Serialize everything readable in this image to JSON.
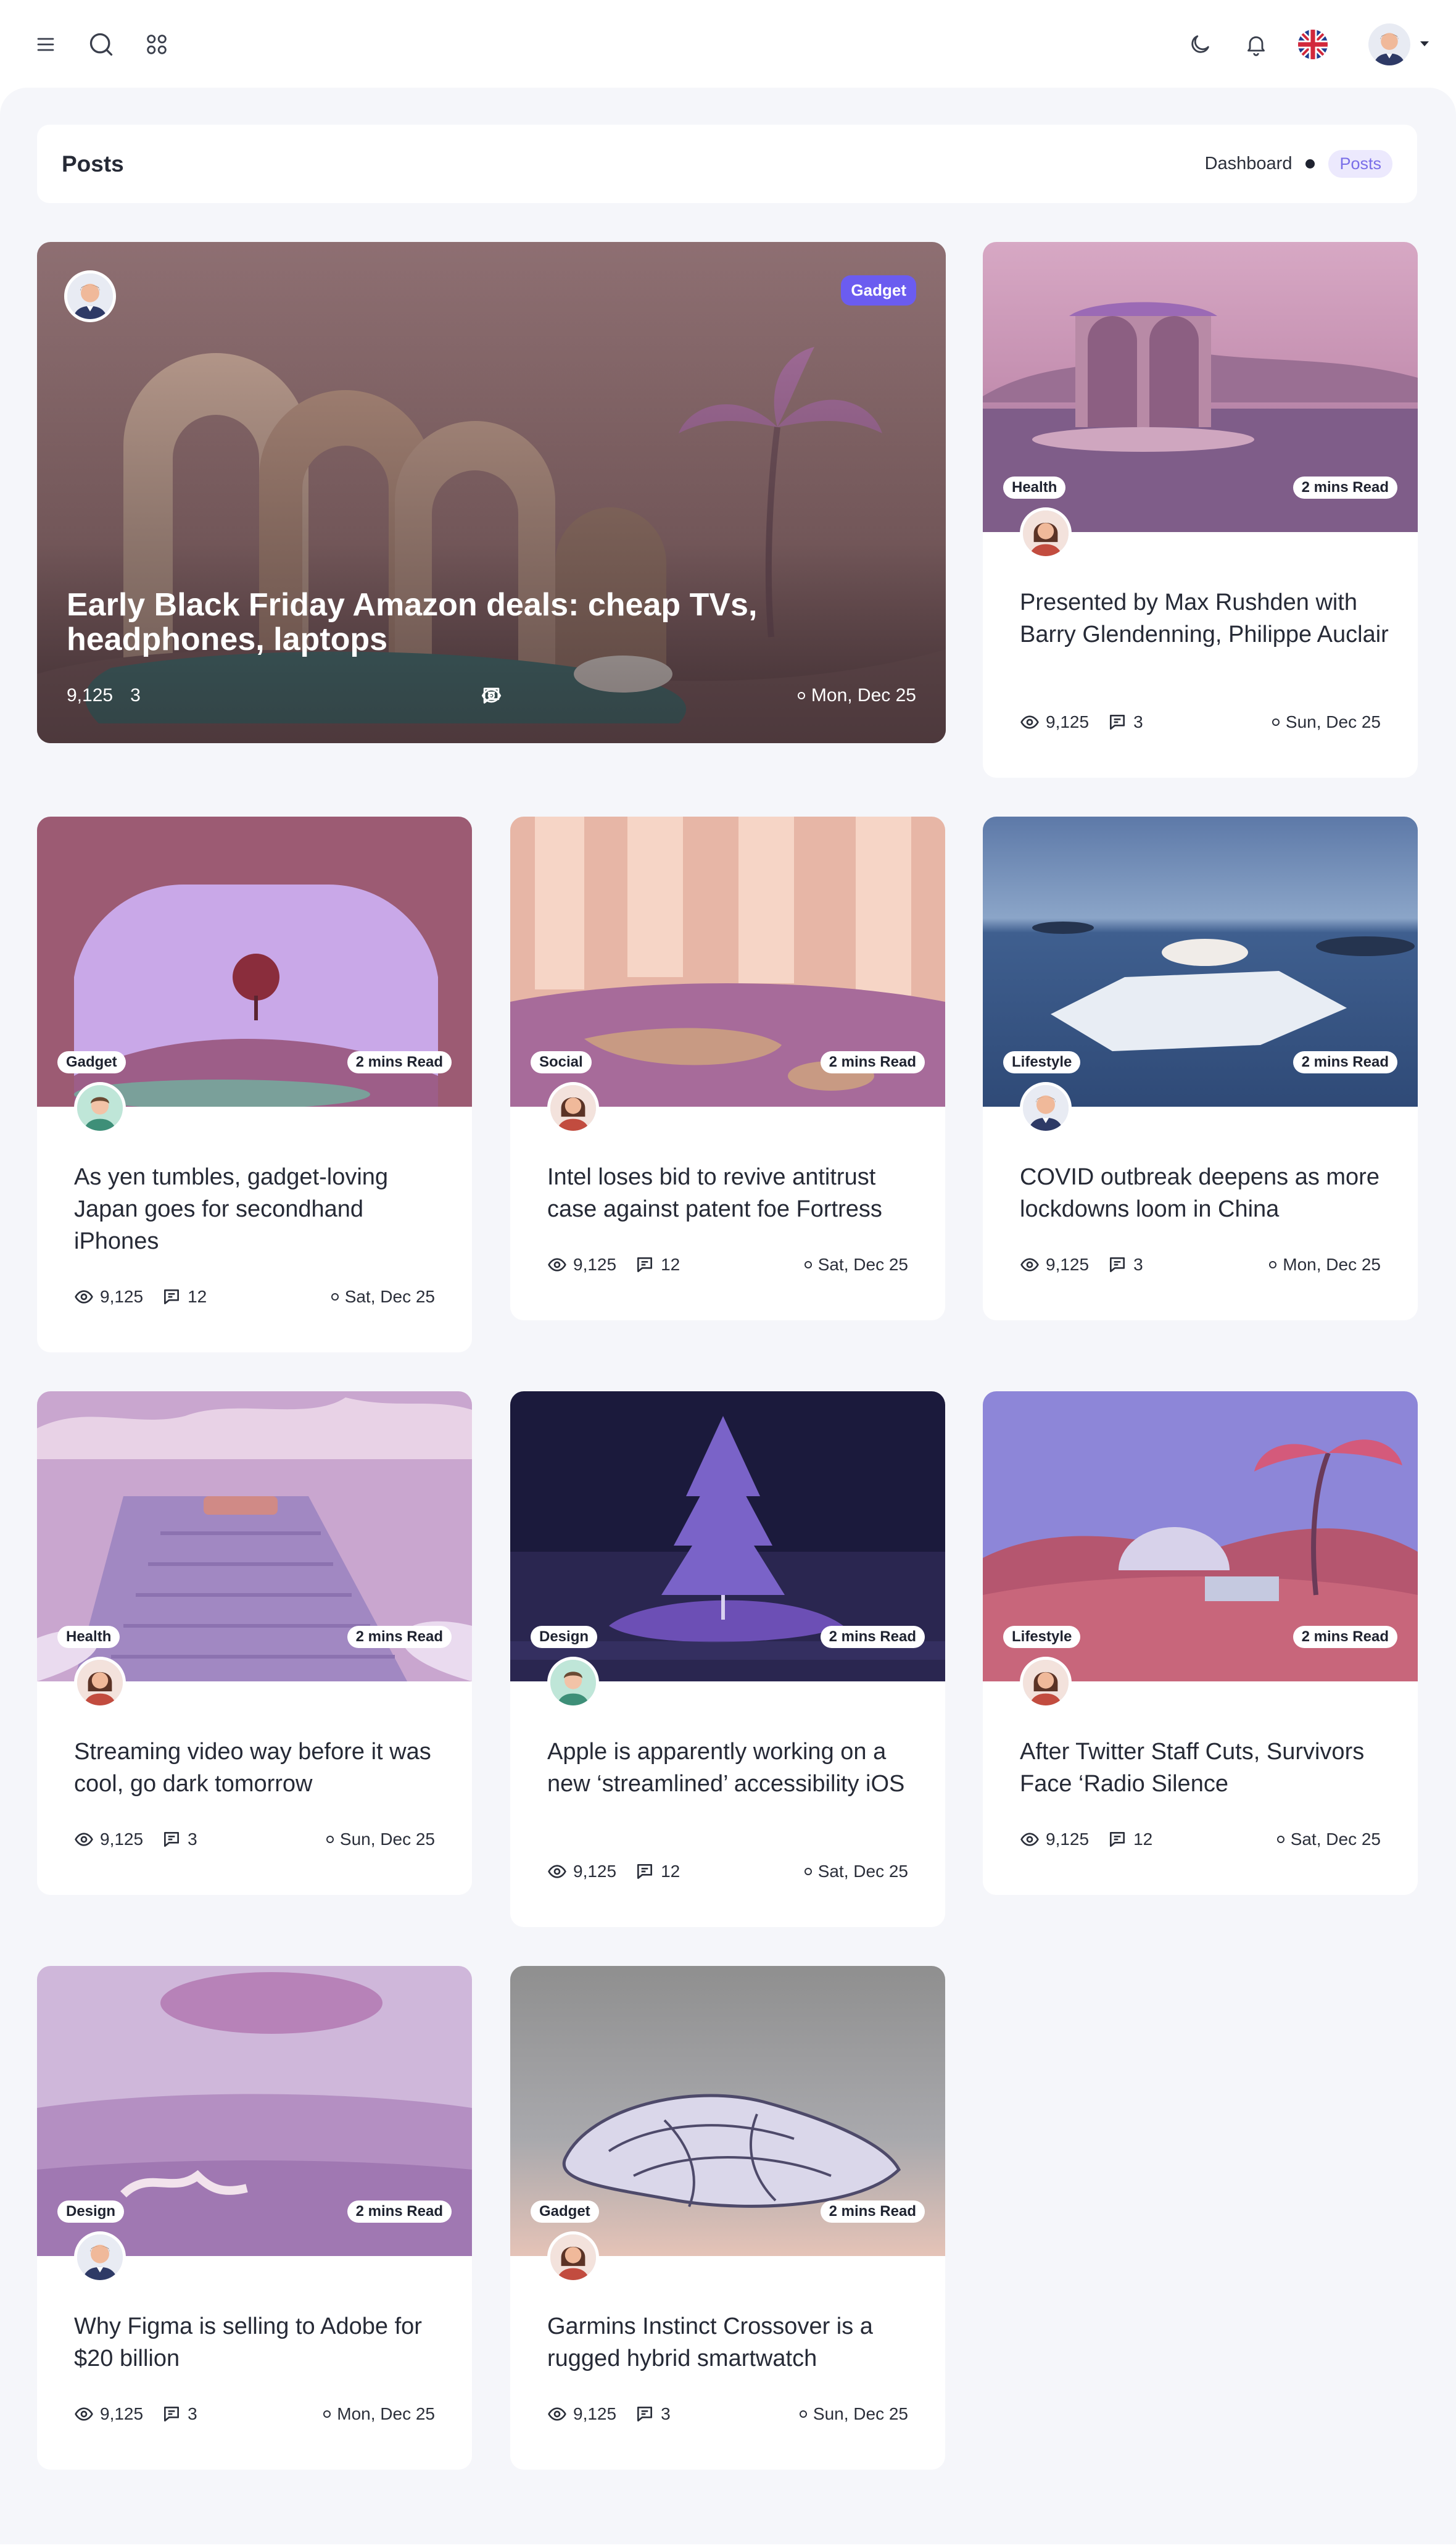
{
  "topbar": {
    "icons": [
      "menu-icon",
      "search-icon",
      "apps-icon",
      "moon-icon",
      "bell-icon",
      "uk-flag-icon",
      "user-avatar",
      "caret-down-icon"
    ]
  },
  "page": {
    "title": "Posts",
    "breadcrumb": {
      "root": "Dashboard",
      "current": "Posts"
    }
  },
  "colors": {
    "accent": "#6b5cf0",
    "badge_bg": "#ece9fd",
    "page_bg": "#f5f6fa"
  },
  "featured": {
    "category": "Gadget",
    "title": "Early Black Friday Amazon deals: cheap TVs, headphones, laptops",
    "views": "9,125",
    "comments": "3",
    "date": "Mon, Dec 25"
  },
  "posts": [
    {
      "category": "Health",
      "read": "2 mins Read",
      "title": "Presented by Max Rushden with Barry Glendenning, Philippe Auclair",
      "views": "9,125",
      "comments": "3",
      "date": "Sun, Dec 25"
    },
    {
      "category": "Gadget",
      "read": "2 mins Read",
      "title": "As yen tumbles, gadget-loving Japan goes for secondhand iPhones",
      "views": "9,125",
      "comments": "12",
      "date": "Sat, Dec 25"
    },
    {
      "category": "Social",
      "read": "2 mins Read",
      "title": "Intel loses bid to revive antitrust case against patent foe Fortress",
      "views": "9,125",
      "comments": "12",
      "date": "Sat, Dec 25"
    },
    {
      "category": "Lifestyle",
      "read": "2 mins Read",
      "title": "COVID outbreak deepens as more lockdowns loom in China",
      "views": "9,125",
      "comments": "3",
      "date": "Mon, Dec 25"
    },
    {
      "category": "Health",
      "read": "2 mins Read",
      "title": "Streaming video way before it was cool, go dark tomorrow",
      "views": "9,125",
      "comments": "3",
      "date": "Sun, Dec 25"
    },
    {
      "category": "Design",
      "read": "2 mins Read",
      "title": "Apple is apparently working on a new ‘streamlined’ accessibility iOS",
      "views": "9,125",
      "comments": "12",
      "date": "Sat, Dec 25"
    },
    {
      "category": "Lifestyle",
      "read": "2 mins Read",
      "title": "After Twitter Staff Cuts, Survivors Face ‘Radio Silence",
      "views": "9,125",
      "comments": "12",
      "date": "Sat, Dec 25"
    },
    {
      "category": "Design",
      "read": "2 mins Read",
      "title": "Why Figma is selling to Adobe for $20 billion",
      "views": "9,125",
      "comments": "3",
      "date": "Mon, Dec 25"
    },
    {
      "category": "Gadget",
      "read": "2 mins Read",
      "title": "Garmins Instinct Crossover is a rugged hybrid smartwatch",
      "views": "9,125",
      "comments": "3",
      "date": "Sun, Dec 25"
    }
  ]
}
